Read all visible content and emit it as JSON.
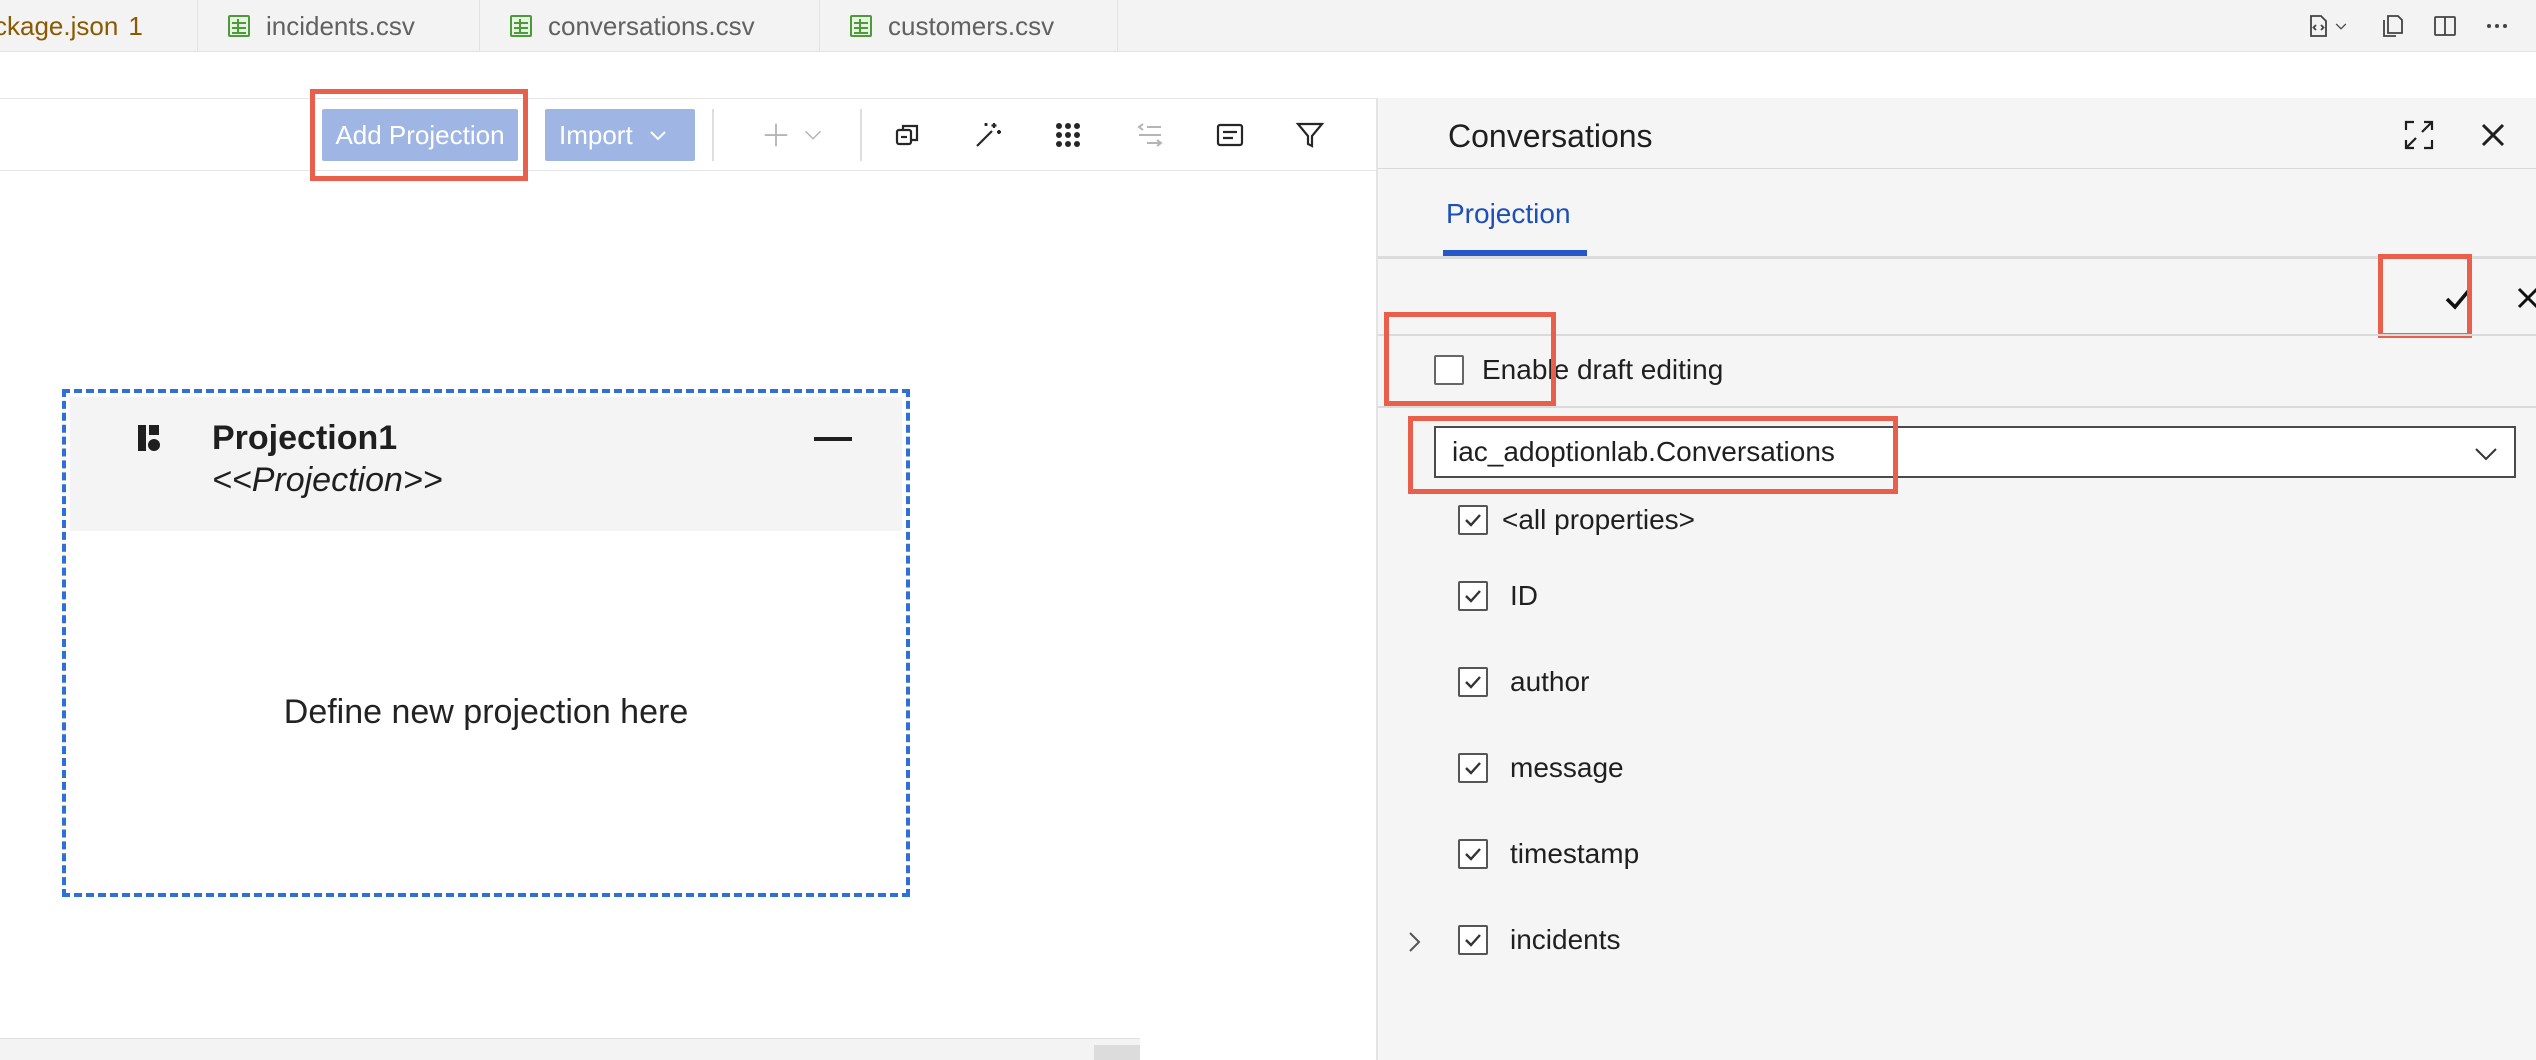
{
  "tabs": [
    {
      "label": "ckage.json",
      "badge": "1"
    },
    {
      "label": "incidents.csv"
    },
    {
      "label": "conversations.csv"
    },
    {
      "label": "customers.csv"
    }
  ],
  "toolbar": {
    "add_projection": "Add Projection",
    "import": "Import"
  },
  "projection_card": {
    "title": "Projection1",
    "stereotype": "<<Projection>>",
    "body": "Define new projection here"
  },
  "panel": {
    "title": "Conversations",
    "tab": "Projection",
    "draft_label": "Enable draft editing",
    "entity": "iac_adoptionlab.Conversations",
    "properties": [
      {
        "label": "<all properties>",
        "checked": true
      },
      {
        "label": "ID",
        "checked": true
      },
      {
        "label": "author",
        "checked": true
      },
      {
        "label": "message",
        "checked": true
      },
      {
        "label": "timestamp",
        "checked": true
      },
      {
        "label": "incidents",
        "checked": true,
        "expandable": true
      }
    ]
  },
  "colors": {
    "highlight": "#e8604c",
    "primary_button": "#9fb6e5",
    "selection_dash": "#2f6fd6",
    "tab_active": "#1d4fb8"
  }
}
